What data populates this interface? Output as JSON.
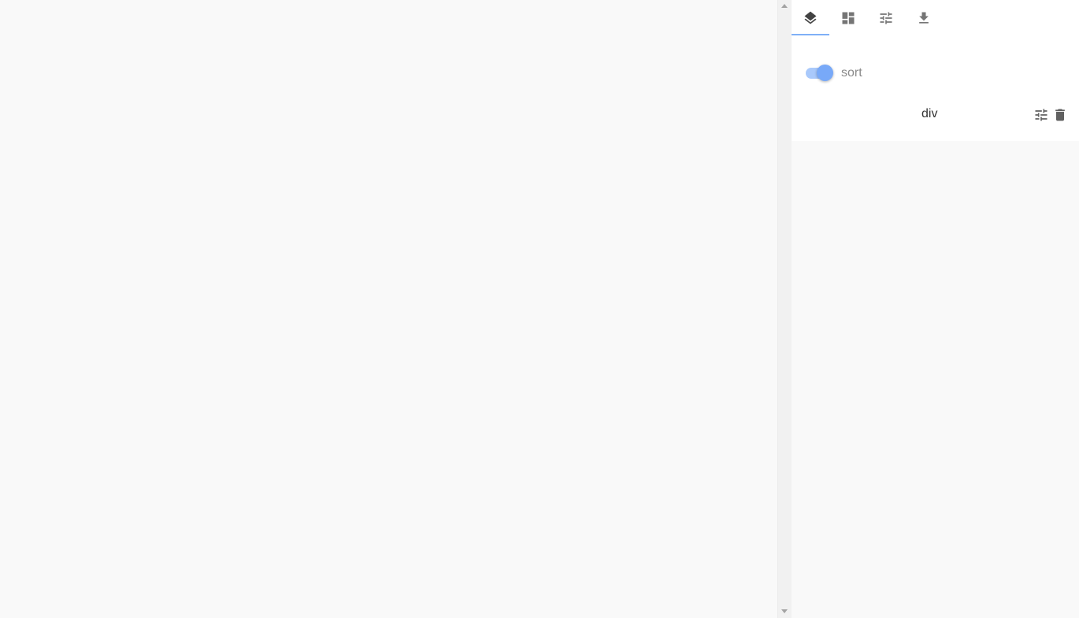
{
  "panel": {
    "tabs": [
      {
        "icon": "layers-icon",
        "active": true
      },
      {
        "icon": "dashboard-icon",
        "active": false
      },
      {
        "icon": "tune-icon",
        "active": false
      },
      {
        "icon": "download-icon",
        "active": false
      }
    ],
    "sort_toggle": {
      "label": "sort",
      "on": true
    },
    "layers": [
      {
        "name": "div",
        "actions": [
          "tune-icon",
          "delete-icon"
        ]
      }
    ]
  },
  "colors": {
    "accent": "#7fb0f7",
    "toggle_knob": "#78a9f8",
    "toggle_track": "#a9c9fb"
  }
}
